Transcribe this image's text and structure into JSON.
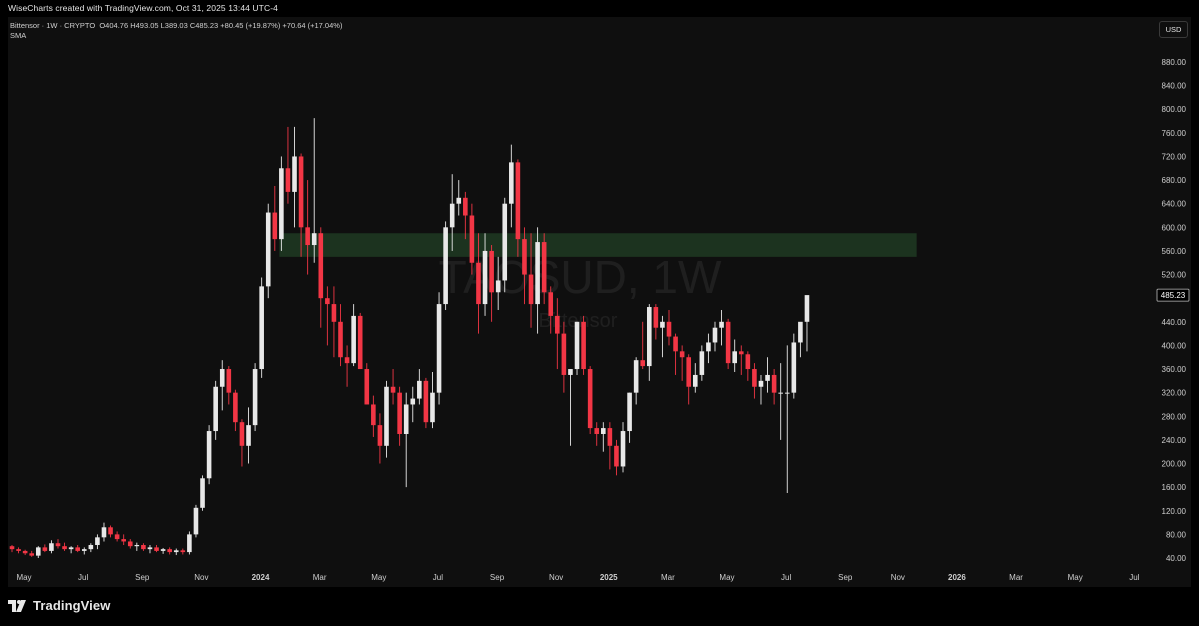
{
  "header": {
    "attribution": "WiseCharts created with TradingView.com, Oct 31, 2025 13:44 UTC-4"
  },
  "legend": {
    "symbol_line": "Bittensor · 1W · CRYPTO",
    "ohlc": "O404.76  H493.05  L389.03  C485.23  +80.45 (+19.87%)  +70.64 (+17.04%)",
    "indicator": "SMA"
  },
  "currency_button": "USD",
  "watermark": {
    "symbol": "TAOSUD, 1W",
    "name": "Bittensor"
  },
  "last_price_label": "485.23",
  "footer": {
    "brand": "TradingView"
  },
  "colors": {
    "up": "#e8e8e8",
    "down": "#f23645",
    "zone": "#1f3a22",
    "background": "#0f0f0f"
  },
  "chart_data": {
    "type": "candlestick",
    "timeframe": "1W",
    "ylim": [
      20,
      920
    ],
    "y_ticks": [
      40,
      80,
      120,
      160,
      200,
      240,
      280,
      320,
      360,
      400,
      440,
      480,
      520,
      560,
      600,
      640,
      680,
      720,
      760,
      800,
      840,
      880
    ],
    "y_tick_labels": [
      "40.00",
      "80.00",
      "120.00",
      "160.00",
      "200.00",
      "240.00",
      "280.00",
      "320.00",
      "360.00",
      "400.00",
      "440.00",
      "480.00",
      "520.00",
      "560.00",
      "600.00",
      "640.00",
      "680.00",
      "720.00",
      "760.00",
      "800.00",
      "840.00",
      "880.00"
    ],
    "x_labels": [
      {
        "label": "May",
        "week": 0
      },
      {
        "label": "Jul",
        "week": 9
      },
      {
        "label": "Sep",
        "week": 18
      },
      {
        "label": "Nov",
        "week": 27
      },
      {
        "label": "2024",
        "week": 36
      },
      {
        "label": "Mar",
        "week": 45
      },
      {
        "label": "May",
        "week": 54
      },
      {
        "label": "Jul",
        "week": 63
      },
      {
        "label": "Sep",
        "week": 72
      },
      {
        "label": "Nov",
        "week": 81
      },
      {
        "label": "2025",
        "week": 89
      },
      {
        "label": "Mar",
        "week": 98
      },
      {
        "label": "May",
        "week": 107
      },
      {
        "label": "Jul",
        "week": 116
      },
      {
        "label": "Sep",
        "week": 125
      },
      {
        "label": "Nov",
        "week": 133
      },
      {
        "label": "2026",
        "week": 142
      },
      {
        "label": "Mar",
        "week": 151
      },
      {
        "label": "May",
        "week": 160
      },
      {
        "label": "Jul",
        "week": 169
      }
    ],
    "zone": {
      "low": 550,
      "high": 590,
      "start_week": 41,
      "end_week": 138
    },
    "last_price": 485.23,
    "candles": [
      [
        60,
        62,
        50,
        55
      ],
      [
        55,
        58,
        48,
        52
      ],
      [
        52,
        54,
        45,
        48
      ],
      [
        48,
        52,
        42,
        44
      ],
      [
        44,
        60,
        40,
        58
      ],
      [
        58,
        63,
        50,
        52
      ],
      [
        52,
        70,
        48,
        65
      ],
      [
        65,
        72,
        56,
        60
      ],
      [
        60,
        66,
        52,
        55
      ],
      [
        55,
        60,
        48,
        58
      ],
      [
        58,
        62,
        50,
        52
      ],
      [
        52,
        58,
        46,
        55
      ],
      [
        55,
        65,
        50,
        62
      ],
      [
        62,
        80,
        55,
        75
      ],
      [
        75,
        100,
        68,
        92
      ],
      [
        92,
        95,
        75,
        80
      ],
      [
        80,
        85,
        68,
        72
      ],
      [
        72,
        80,
        62,
        68
      ],
      [
        68,
        72,
        56,
        60
      ],
      [
        60,
        66,
        52,
        62
      ],
      [
        62,
        65,
        52,
        55
      ],
      [
        55,
        62,
        48,
        58
      ],
      [
        58,
        62,
        50,
        52
      ],
      [
        52,
        57,
        47,
        55
      ],
      [
        55,
        58,
        46,
        50
      ],
      [
        50,
        56,
        45,
        53
      ],
      [
        53,
        56,
        46,
        50
      ],
      [
        50,
        85,
        46,
        80
      ],
      [
        80,
        130,
        75,
        125
      ],
      [
        125,
        180,
        120,
        175
      ],
      [
        175,
        265,
        165,
        255
      ],
      [
        255,
        340,
        240,
        330
      ],
      [
        330,
        375,
        290,
        360
      ],
      [
        360,
        365,
        300,
        320
      ],
      [
        320,
        325,
        255,
        270
      ],
      [
        270,
        275,
        195,
        230
      ],
      [
        230,
        295,
        200,
        265
      ],
      [
        265,
        370,
        255,
        360
      ],
      [
        360,
        515,
        345,
        500
      ],
      [
        500,
        640,
        480,
        625
      ],
      [
        625,
        670,
        560,
        580
      ],
      [
        580,
        720,
        560,
        700
      ],
      [
        700,
        770,
        640,
        660
      ],
      [
        660,
        770,
        600,
        720
      ],
      [
        720,
        725,
        550,
        600
      ],
      [
        600,
        680,
        520,
        570
      ],
      [
        570,
        785,
        540,
        590
      ],
      [
        590,
        600,
        430,
        480
      ],
      [
        480,
        500,
        400,
        470
      ],
      [
        470,
        500,
        380,
        440
      ],
      [
        440,
        470,
        365,
        380
      ],
      [
        380,
        400,
        330,
        370
      ],
      [
        370,
        470,
        365,
        450
      ],
      [
        450,
        455,
        360,
        360
      ],
      [
        360,
        370,
        300,
        300
      ],
      [
        300,
        315,
        245,
        265
      ],
      [
        265,
        285,
        200,
        230
      ],
      [
        230,
        340,
        210,
        330
      ],
      [
        330,
        360,
        300,
        320
      ],
      [
        320,
        330,
        230,
        250
      ],
      [
        250,
        320,
        160,
        300
      ],
      [
        300,
        330,
        270,
        310
      ],
      [
        310,
        360,
        300,
        340
      ],
      [
        340,
        345,
        260,
        270
      ],
      [
        270,
        355,
        260,
        320
      ],
      [
        320,
        490,
        300,
        470
      ],
      [
        470,
        610,
        460,
        600
      ],
      [
        600,
        690,
        560,
        640
      ],
      [
        640,
        680,
        620,
        650
      ],
      [
        650,
        660,
        580,
        620
      ],
      [
        620,
        640,
        520,
        540
      ],
      [
        540,
        590,
        420,
        470
      ],
      [
        470,
        590,
        450,
        560
      ],
      [
        560,
        570,
        440,
        490
      ],
      [
        490,
        550,
        460,
        510
      ],
      [
        510,
        650,
        490,
        640
      ],
      [
        640,
        740,
        600,
        710
      ],
      [
        710,
        715,
        550,
        580
      ],
      [
        580,
        600,
        470,
        520
      ],
      [
        520,
        590,
        430,
        470
      ],
      [
        470,
        600,
        420,
        575
      ],
      [
        575,
        590,
        470,
        490
      ],
      [
        490,
        500,
        420,
        450
      ],
      [
        450,
        480,
        360,
        420
      ],
      [
        420,
        440,
        320,
        350
      ],
      [
        350,
        360,
        230,
        360
      ],
      [
        360,
        440,
        350,
        440
      ],
      [
        440,
        450,
        350,
        360
      ],
      [
        360,
        365,
        250,
        260
      ],
      [
        260,
        270,
        230,
        250
      ],
      [
        250,
        270,
        220,
        260
      ],
      [
        260,
        270,
        190,
        230
      ],
      [
        230,
        240,
        180,
        195
      ],
      [
        195,
        270,
        185,
        255
      ],
      [
        255,
        320,
        235,
        320
      ],
      [
        320,
        380,
        300,
        375
      ],
      [
        375,
        440,
        360,
        365
      ],
      [
        365,
        470,
        340,
        465
      ],
      [
        465,
        470,
        410,
        430
      ],
      [
        430,
        450,
        380,
        440
      ],
      [
        440,
        460,
        400,
        415
      ],
      [
        415,
        420,
        350,
        390
      ],
      [
        390,
        400,
        340,
        380
      ],
      [
        380,
        385,
        300,
        330
      ],
      [
        330,
        370,
        320,
        350
      ],
      [
        350,
        400,
        340,
        390
      ],
      [
        390,
        420,
        370,
        405
      ],
      [
        405,
        440,
        390,
        430
      ],
      [
        430,
        460,
        400,
        440
      ],
      [
        440,
        445,
        360,
        370
      ],
      [
        370,
        410,
        355,
        390
      ],
      [
        390,
        400,
        350,
        385
      ],
      [
        385,
        390,
        340,
        360
      ],
      [
        360,
        370,
        310,
        330
      ],
      [
        330,
        350,
        300,
        340
      ],
      [
        340,
        380,
        320,
        350
      ],
      [
        350,
        360,
        300,
        320
      ],
      [
        320,
        370,
        240,
        320
      ],
      [
        320,
        400,
        150,
        320
      ],
      [
        320,
        420,
        310,
        405
      ],
      [
        405,
        420,
        380,
        440
      ],
      [
        440,
        460,
        390,
        485.23
      ]
    ]
  }
}
